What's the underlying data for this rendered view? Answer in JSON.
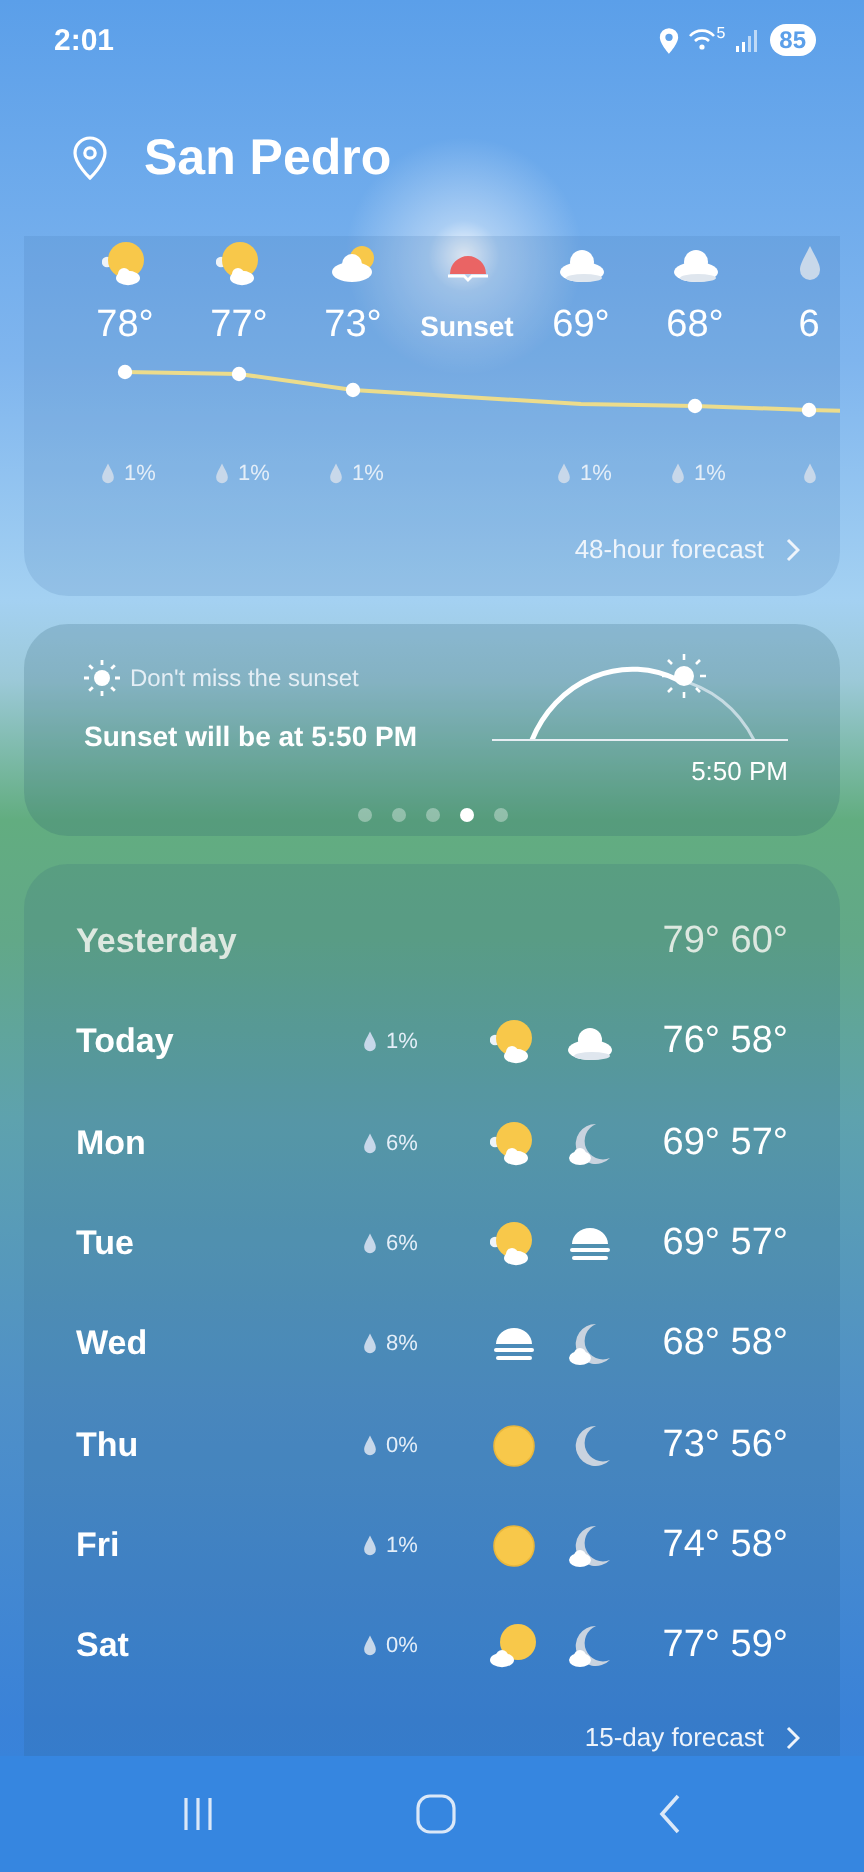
{
  "status_bar": {
    "time": "2:01",
    "wifi_label": "5",
    "battery": "85"
  },
  "location": {
    "name": "San Pedro"
  },
  "hourly": {
    "items": [
      {
        "kind": "sun-cloud",
        "label": "78°",
        "precip": "1%"
      },
      {
        "kind": "sun-cloud",
        "label": "77°",
        "precip": "1%"
      },
      {
        "kind": "cloud-sun",
        "label": "73°",
        "precip": "1%"
      },
      {
        "kind": "sunset",
        "label": "Sunset"
      },
      {
        "kind": "cloud",
        "label": "69°",
        "precip": "1%"
      },
      {
        "kind": "cloud",
        "label": "68°",
        "precip": "1%"
      },
      {
        "kind": "drop",
        "label": "6"
      }
    ],
    "link": "48-hour forecast"
  },
  "sunset": {
    "title": "Don't miss the sunset",
    "message": "Sunset will be at 5:50 PM",
    "time": "5:50 PM",
    "pages": [
      {
        "selected": false
      },
      {
        "selected": false
      },
      {
        "selected": false
      },
      {
        "selected": true
      },
      {
        "selected": false
      }
    ]
  },
  "daily": {
    "rows": [
      {
        "kind": "yesterday",
        "day": "Yesterday",
        "temps": "79° 60°"
      },
      {
        "kind": "day",
        "day": "Today",
        "precip": "1%",
        "icons": [
          {
            "kind": "sun-cloud"
          },
          {
            "kind": "cloud"
          }
        ],
        "temps": "76° 58°"
      },
      {
        "kind": "day",
        "day": "Mon",
        "precip": "6%",
        "icons": [
          {
            "kind": "sun-cloud"
          },
          {
            "kind": "moon-cloud"
          }
        ],
        "temps": "69° 57°"
      },
      {
        "kind": "day",
        "day": "Tue",
        "precip": "6%",
        "icons": [
          {
            "kind": "sun-cloud"
          },
          {
            "kind": "fog"
          }
        ],
        "temps": "69° 57°"
      },
      {
        "kind": "day",
        "day": "Wed",
        "precip": "8%",
        "icons": [
          {
            "kind": "fog"
          },
          {
            "kind": "moon-cloud"
          }
        ],
        "temps": "68° 58°"
      },
      {
        "kind": "day",
        "day": "Thu",
        "precip": "0%",
        "icons": [
          {
            "kind": "sun"
          },
          {
            "kind": "moon"
          }
        ],
        "temps": "73° 56°"
      },
      {
        "kind": "day",
        "day": "Fri",
        "precip": "1%",
        "icons": [
          {
            "kind": "sun"
          },
          {
            "kind": "moon-cloud"
          }
        ],
        "temps": "74° 58°"
      },
      {
        "kind": "day",
        "day": "Sat",
        "precip": "0%",
        "icons": [
          {
            "kind": "sun-small-cloud"
          },
          {
            "kind": "moon-cloud"
          }
        ],
        "temps": "77° 59°"
      }
    ],
    "link": "15-day forecast"
  }
}
